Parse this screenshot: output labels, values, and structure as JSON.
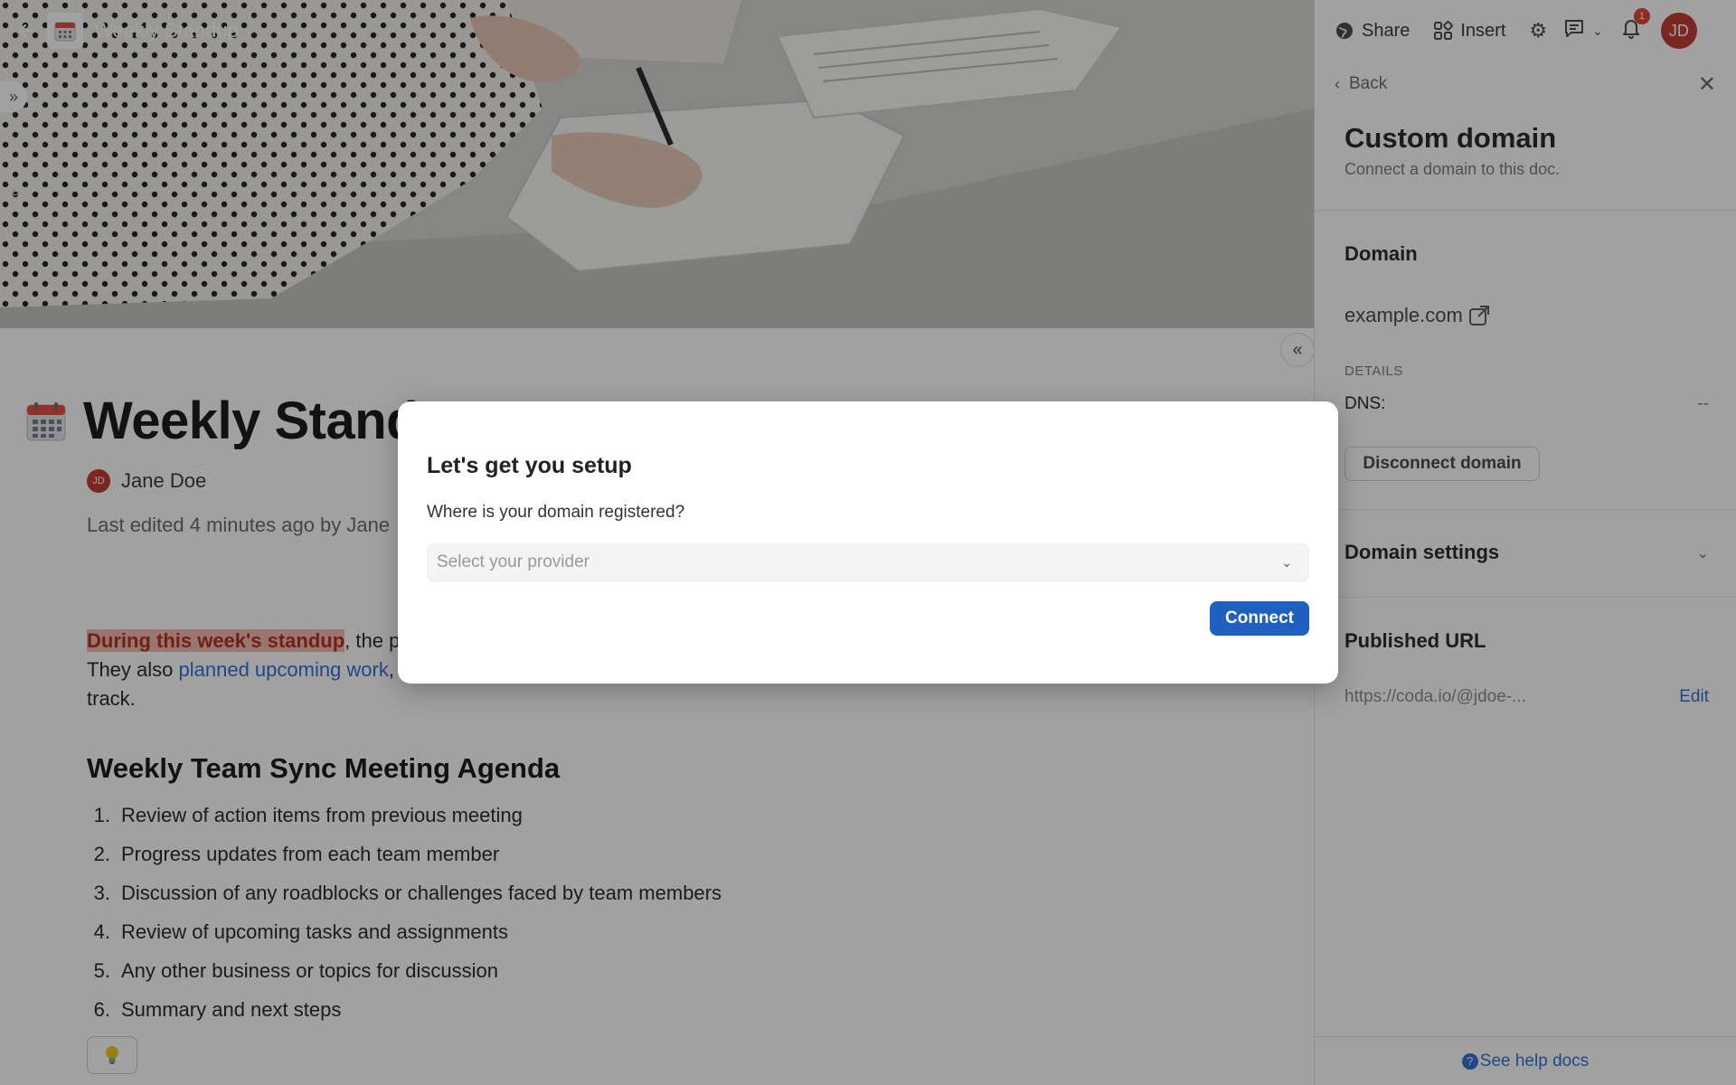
{
  "doc": {
    "title_short": "Weekly Standup",
    "title_visible": "Weekly Stand",
    "author": "Jane Doe",
    "author_initials": "JD",
    "last_edited": "Last edited 4 minutes ago by Jane",
    "paragraph": {
      "highlight": "During this week's standup",
      "after_highlight": ", the pr",
      "line2_start": "They also ",
      "link": "planned upcoming work",
      "line2_end": ",",
      "line3": "track."
    },
    "agenda_heading": "Weekly Team Sync Meeting Agenda",
    "agenda_items": [
      {
        "num": "1.",
        "text": "Review of action items from previous meeting"
      },
      {
        "num": "2.",
        "text": "Progress updates from each team member"
      },
      {
        "num": "3.",
        "text": "Discussion of any roadblocks or challenges faced by team members"
      },
      {
        "num": "4.",
        "text": "Review of upcoming tasks and assignments"
      },
      {
        "num": "5.",
        "text": "Any other business or topics for discussion"
      },
      {
        "num": "6.",
        "text": "Summary and next steps"
      }
    ]
  },
  "toolbar": {
    "share_label": "Share",
    "insert_label": "Insert",
    "notification_count": "1",
    "user_initials": "JD"
  },
  "panel": {
    "back_label": "Back",
    "title": "Custom domain",
    "subtitle": "Connect a domain to this doc.",
    "domain_heading": "Domain",
    "domain_value": "example.com",
    "details_label": "DETAILS",
    "dns_label": "DNS:",
    "dns_value": "--",
    "disconnect_label": "Disconnect domain",
    "domain_settings_heading": "Domain settings",
    "published_url_heading": "Published URL",
    "published_url": "https://coda.io/@jdoe-...",
    "edit_label": "Edit",
    "help_label": "See help docs"
  },
  "modal": {
    "title": "Let's get you setup",
    "question": "Where is your domain registered?",
    "select_placeholder": "Select your provider",
    "connect_label": "Connect"
  },
  "colors": {
    "accent_blue": "#1f5fbf",
    "link_blue": "#2a6bd3",
    "avatar_red": "#c0352b",
    "highlight_bg": "#f2b9b0",
    "highlight_text": "#b0271a"
  }
}
